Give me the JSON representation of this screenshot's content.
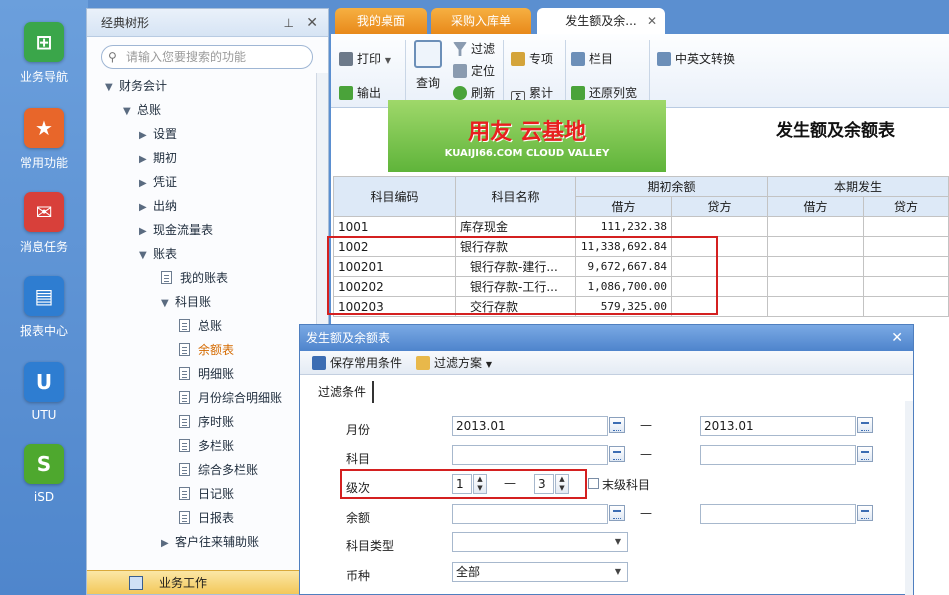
{
  "leftnav": {
    "items": [
      {
        "label": "业务导航",
        "icon": "business-nav-icon",
        "color": "#3aa64a"
      },
      {
        "label": "常用功能",
        "icon": "star-icon",
        "color": "#e8662a"
      },
      {
        "label": "消息任务",
        "icon": "mail-icon",
        "color": "#d8403a"
      },
      {
        "label": "报表中心",
        "icon": "report-icon",
        "color": "#2e7dd1"
      },
      {
        "label": "UTU",
        "icon": "utu-icon",
        "color": "#2e7dd1"
      },
      {
        "label": "iSD",
        "icon": "isd-icon",
        "color": "#4ea82e"
      }
    ]
  },
  "tree": {
    "title": "经典树形",
    "search_placeholder": "请输入您要搜索的功能",
    "nodes": [
      {
        "label": "财务会计"
      },
      {
        "label": "总账"
      },
      {
        "label": "设置"
      },
      {
        "label": "期初"
      },
      {
        "label": "凭证"
      },
      {
        "label": "出纳"
      },
      {
        "label": "现金流量表"
      },
      {
        "label": "账表"
      },
      {
        "label": "我的账表"
      },
      {
        "label": "科目账"
      },
      {
        "label": "总账"
      },
      {
        "label": "余额表"
      },
      {
        "label": "明细账"
      },
      {
        "label": "月份综合明细账"
      },
      {
        "label": "序时账"
      },
      {
        "label": "多栏账"
      },
      {
        "label": "综合多栏账"
      },
      {
        "label": "日记账"
      },
      {
        "label": "日报表"
      },
      {
        "label": "客户往来辅助账"
      }
    ],
    "bottom_label": "业务工作"
  },
  "tabs": [
    {
      "label": "我的桌面"
    },
    {
      "label": "采购入库单"
    },
    {
      "label": "发生额及余..."
    }
  ],
  "toolbar": {
    "print": "打印",
    "output": "输出",
    "query": "查询",
    "filter": "过滤",
    "locate": "定位",
    "refresh": "刷新",
    "special": "专项",
    "cumulative": "累计",
    "column": "栏目",
    "restore": "还原列宽",
    "convert": "中英文转换"
  },
  "banner": {
    "main": "用友 云基地",
    "sub": "KUAIJI66.COM  CLOUD VALLEY",
    "accent": "#e8201f"
  },
  "report": {
    "title": "发生额及余额表",
    "headers": {
      "code": "科目编码",
      "name": "科目名称",
      "opening": "期初余额",
      "current": "本期发生",
      "debit": "借方",
      "credit": "贷方"
    },
    "rows": [
      {
        "code": "1001",
        "name": "库存现金",
        "debit": "111,232.38"
      },
      {
        "code": "1002",
        "name": "银行存款",
        "debit": "11,338,692.84"
      },
      {
        "code": "100201",
        "name": "银行存款-建行...",
        "debit": "9,672,667.84"
      },
      {
        "code": "100202",
        "name": "银行存款-工行...",
        "debit": "1,086,700.00"
      },
      {
        "code": "100203",
        "name": "交行存款",
        "debit": "579,325.00"
      }
    ]
  },
  "dialog": {
    "title": "发生额及余额表",
    "save_label": "保存常用条件",
    "scheme_label": "过滤方案",
    "tab_label": "过滤条件",
    "labels": {
      "month": "月份",
      "subject": "科目",
      "level": "级次",
      "balance": "余额",
      "subject_type": "科目类型",
      "currency": "币种"
    },
    "month_from": "2013.01",
    "month_to": "2013.01",
    "level_from": "1",
    "level_to": "3",
    "last_level_label": "末级科目",
    "currency_value": "全部",
    "dash": "—"
  }
}
